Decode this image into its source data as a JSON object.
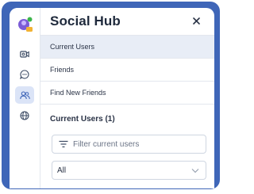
{
  "header": {
    "title": "Social Hub",
    "close_icon": "close-icon"
  },
  "rail": {
    "logo_icon": "avatar-logo-icon",
    "items": [
      {
        "name": "video-icon",
        "active": false
      },
      {
        "name": "chat-icon",
        "active": false
      },
      {
        "name": "users-icon",
        "active": true
      },
      {
        "name": "globe-icon",
        "active": false
      }
    ]
  },
  "menu": {
    "items": [
      {
        "label": "Current Users",
        "selected": true
      },
      {
        "label": "Friends",
        "selected": false
      },
      {
        "label": "Find New Friends",
        "selected": false
      }
    ]
  },
  "section": {
    "title": "Current Users (1)"
  },
  "filter": {
    "placeholder": "Filter current users",
    "icon": "filter-icon"
  },
  "select": {
    "value": "All"
  },
  "colors": {
    "frame": "#3f66b8",
    "accent": "#3f66b8",
    "selected_bg": "#e8edf6"
  }
}
